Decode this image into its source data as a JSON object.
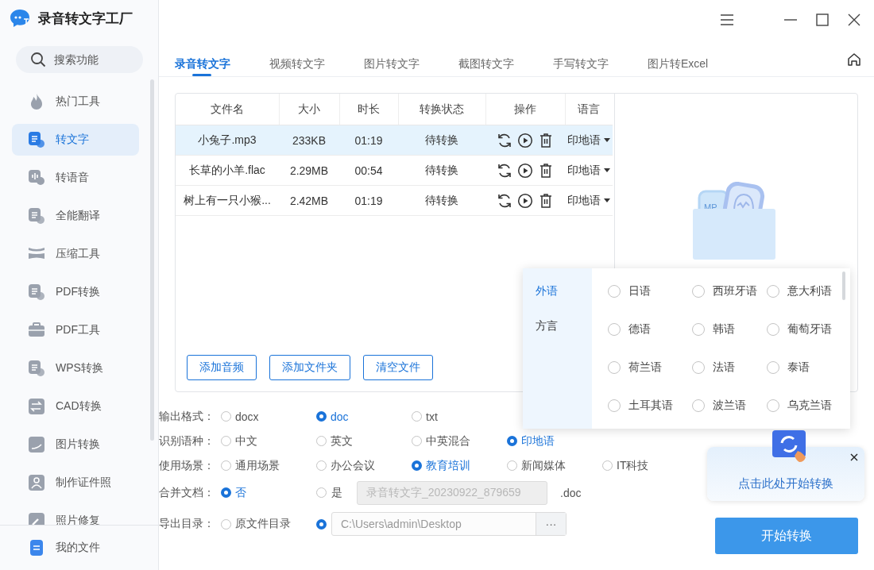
{
  "app": {
    "title": "录音转文字工厂"
  },
  "sidebar": {
    "search": {
      "placeholder": "搜索功能"
    },
    "items": [
      {
        "label": "热门工具",
        "selected": false
      },
      {
        "label": "转文字",
        "selected": true
      },
      {
        "label": "转语音",
        "selected": false
      },
      {
        "label": "全能翻译",
        "selected": false
      },
      {
        "label": "压缩工具",
        "selected": false
      },
      {
        "label": "PDF转换",
        "selected": false
      },
      {
        "label": "PDF工具",
        "selected": false
      },
      {
        "label": "WPS转换",
        "selected": false
      },
      {
        "label": "CAD转换",
        "selected": false
      },
      {
        "label": "图片转换",
        "selected": false
      },
      {
        "label": "制作证件照",
        "selected": false
      },
      {
        "label": "照片修复",
        "selected": false
      }
    ],
    "footer": {
      "label": "我的文件"
    }
  },
  "tabs": [
    {
      "label": "录音转文字",
      "selected": true
    },
    {
      "label": "视频转文字",
      "selected": false
    },
    {
      "label": "图片转文字",
      "selected": false
    },
    {
      "label": "截图转文字",
      "selected": false
    },
    {
      "label": "手写转文字",
      "selected": false
    },
    {
      "label": "图片转Excel",
      "selected": false
    }
  ],
  "file_table": {
    "columns": [
      "文件名",
      "大小",
      "时长",
      "转换状态",
      "操作",
      "语言"
    ],
    "rows": [
      {
        "name": "小兔子.mp3",
        "size": "233KB",
        "duration": "01:19",
        "status": "待转换",
        "language": "印地语",
        "selected": true
      },
      {
        "name": "长草的小羊.flac",
        "size": "2.29MB",
        "duration": "00:54",
        "status": "待转换",
        "language": "印地语",
        "selected": false
      },
      {
        "name": "树上有一只小猴...",
        "size": "2.42MB",
        "duration": "01:19",
        "status": "待转换",
        "language": "印地语",
        "selected": false
      }
    ]
  },
  "file_buttons": [
    "添加音频",
    "添加文件夹",
    "清空文件"
  ],
  "preview": {
    "label": "MP"
  },
  "options": [
    {
      "label": "输出格式：",
      "choices": [
        {
          "label": "docx",
          "selected": false
        },
        {
          "label": "doc",
          "selected": true
        },
        {
          "label": "txt",
          "selected": false
        }
      ]
    },
    {
      "label": "识别语种：",
      "choices": [
        {
          "label": "中文",
          "selected": false
        },
        {
          "label": "英文",
          "selected": false
        },
        {
          "label": "中英混合",
          "selected": false
        },
        {
          "label": "印地语",
          "selected": true
        }
      ]
    },
    {
      "label": "使用场景：",
      "choices": [
        {
          "label": "通用场景",
          "selected": false
        },
        {
          "label": "办公会议",
          "selected": false
        },
        {
          "label": "教育培训",
          "selected": true
        },
        {
          "label": "新闻媒体",
          "selected": false
        },
        {
          "label": "IT科技",
          "selected": false
        }
      ]
    },
    {
      "label": "合并文档：",
      "choices": [
        {
          "label": "否",
          "selected": true
        },
        {
          "label": "是",
          "selected": false,
          "field": {
            "value": "录音转文字_20230922_879659",
            "disabled": true
          },
          "suffix": ".doc"
        }
      ]
    },
    {
      "label": "导出目录：",
      "choices": [
        {
          "label": "原文件目录",
          "selected": false
        },
        {
          "selected": true,
          "field": {
            "value": "C:\\Users\\admin\\Desktop",
            "disabled": false
          },
          "browse": "···"
        }
      ]
    }
  ],
  "language_popup": {
    "categories": [
      {
        "label": "外语",
        "selected": true
      },
      {
        "label": "方言",
        "selected": false
      }
    ],
    "languages": [
      {
        "label": "日语",
        "selected": false
      },
      {
        "label": "西班牙语",
        "selected": false
      },
      {
        "label": "意大利语",
        "selected": false
      },
      {
        "label": "德语",
        "selected": false
      },
      {
        "label": "韩语",
        "selected": false
      },
      {
        "label": "葡萄牙语",
        "selected": false
      },
      {
        "label": "荷兰语",
        "selected": false
      },
      {
        "label": "法语",
        "selected": false
      },
      {
        "label": "泰语",
        "selected": false
      },
      {
        "label": "土耳其语",
        "selected": false
      },
      {
        "label": "波兰语",
        "selected": false
      },
      {
        "label": "乌克兰语",
        "selected": false
      }
    ]
  },
  "tooltip": {
    "text": "点击此处开始转换"
  },
  "start_button": "开始转换"
}
